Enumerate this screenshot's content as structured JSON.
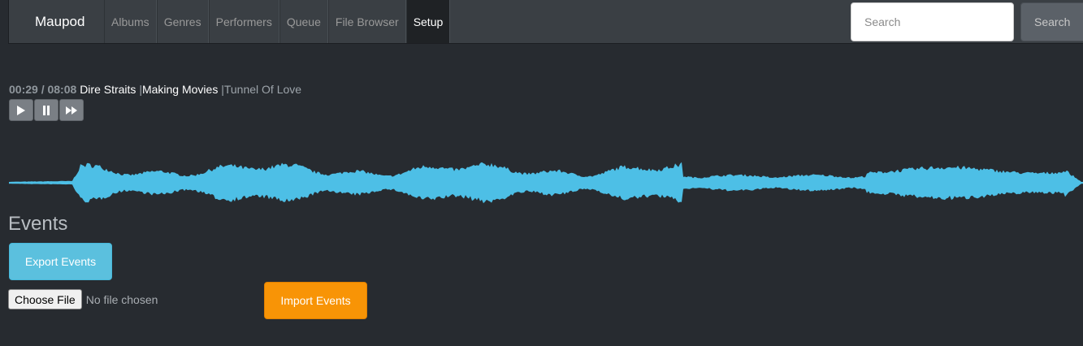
{
  "navbar": {
    "brand": "Maupod",
    "items": [
      {
        "label": "Albums",
        "active": false
      },
      {
        "label": "Genres",
        "active": false
      },
      {
        "label": "Performers",
        "active": false
      },
      {
        "label": "Queue",
        "active": false
      },
      {
        "label": "File Browser",
        "active": false
      },
      {
        "label": "Setup",
        "active": true
      }
    ],
    "search": {
      "placeholder": "Search",
      "value": "",
      "button_label": "Search"
    }
  },
  "player": {
    "time": "00:29 / 08:08",
    "artist": "Dire Straits",
    "separator": "|",
    "album": "Making Movies",
    "track": "Tunnel Of Love",
    "controls": [
      {
        "icon": "play-icon"
      },
      {
        "icon": "pause-icon"
      },
      {
        "icon": "fast-forward-icon"
      }
    ],
    "waveform_color": "#4dbfe6"
  },
  "events": {
    "heading": "Events",
    "export_label": "Export Events",
    "choose_file_label": "Choose File",
    "no_file_text": "No file chosen",
    "import_label": "Import Events"
  },
  "colors": {
    "background": "#272b30",
    "navbar": "#3a3f44",
    "info": "#5bc0de",
    "warning": "#f89406"
  }
}
